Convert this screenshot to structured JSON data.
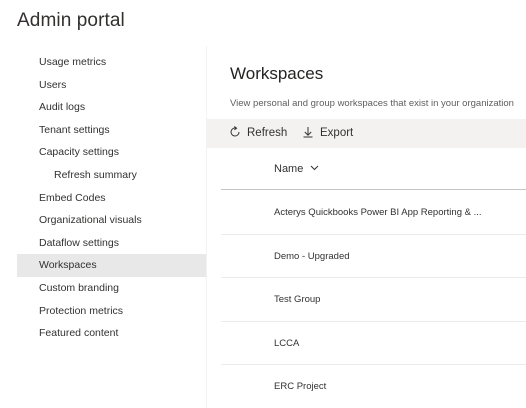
{
  "header": {
    "title": "Admin portal"
  },
  "sidebar": {
    "items": [
      {
        "label": "Usage metrics"
      },
      {
        "label": "Users"
      },
      {
        "label": "Audit logs"
      },
      {
        "label": "Tenant settings"
      },
      {
        "label": "Capacity settings"
      },
      {
        "label": "Refresh summary"
      },
      {
        "label": "Embed Codes"
      },
      {
        "label": "Organizational visuals"
      },
      {
        "label": "Dataflow settings"
      },
      {
        "label": "Workspaces"
      },
      {
        "label": "Custom branding"
      },
      {
        "label": "Protection metrics"
      },
      {
        "label": "Featured content"
      }
    ],
    "active": "Workspaces"
  },
  "main": {
    "title": "Workspaces",
    "description": "View personal and group workspaces that exist in your organization",
    "toolbar": {
      "refresh_label": "Refresh",
      "export_label": "Export"
    },
    "table": {
      "column_name": "Name",
      "rows": [
        {
          "name": "Acterys Quickbooks Power BI App Reporting & ..."
        },
        {
          "name": "Demo - Upgraded"
        },
        {
          "name": "Test Group"
        },
        {
          "name": "LCCA"
        },
        {
          "name": "ERC Project"
        }
      ]
    }
  },
  "colors": {
    "active_item_bg": "#e8e8e8",
    "toolbar_bg": "#f3f2f1",
    "text_primary": "#323130",
    "text_secondary": "#605e5c"
  }
}
